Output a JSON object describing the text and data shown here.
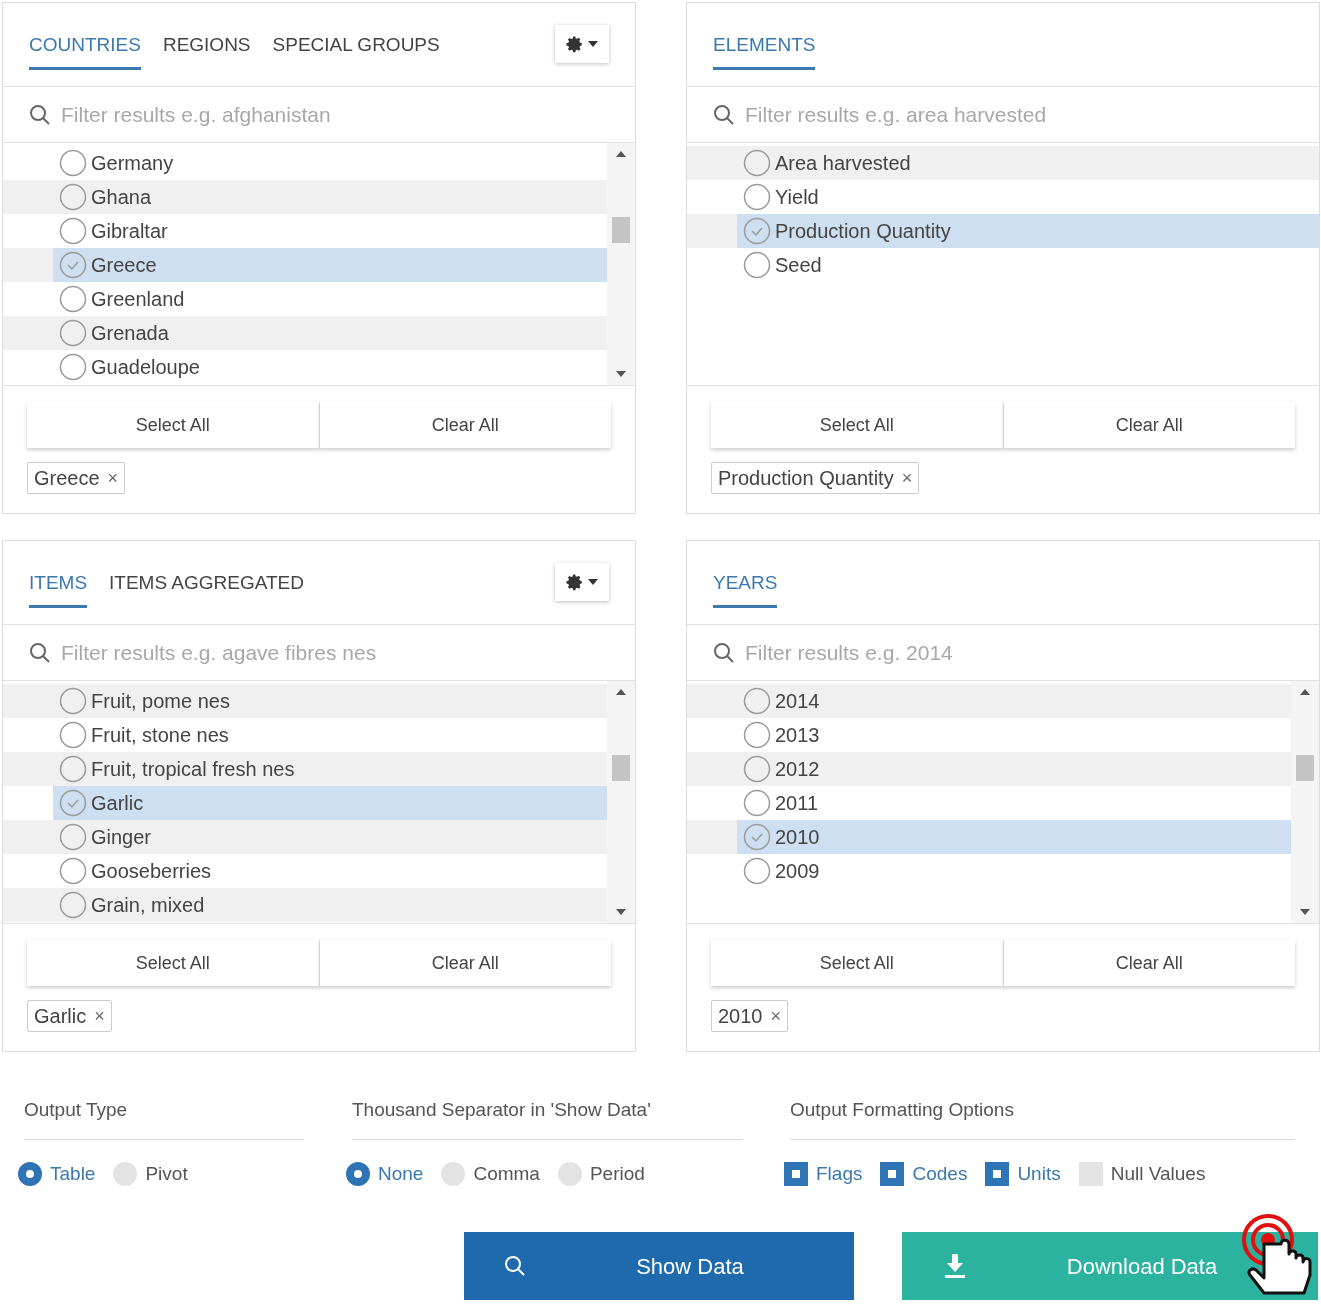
{
  "panels": [
    {
      "tabs": [
        {
          "label": "COUNTRIES",
          "selected": true
        },
        {
          "label": "REGIONS",
          "selected": false
        },
        {
          "label": "SPECIAL GROUPS",
          "selected": false
        }
      ],
      "settings_button": true,
      "search": {
        "placeholder": "Filter results e.g. afghanistan"
      },
      "scrollable": true,
      "first_row_shaded": false,
      "items": [
        {
          "label": "Germany",
          "selected": false
        },
        {
          "label": "Ghana",
          "selected": false
        },
        {
          "label": "Gibraltar",
          "selected": false
        },
        {
          "label": "Greece",
          "selected": true
        },
        {
          "label": "Greenland",
          "selected": false
        },
        {
          "label": "Grenada",
          "selected": false
        },
        {
          "label": "Guadeloupe",
          "selected": false
        }
      ],
      "select_all": "Select All",
      "clear_all": "Clear All",
      "chips": [
        {
          "label": "Greece",
          "remove": "×"
        }
      ]
    },
    {
      "tabs": [
        {
          "label": "ELEMENTS",
          "selected": true
        }
      ],
      "settings_button": false,
      "search": {
        "placeholder": "Filter results e.g. area harvested"
      },
      "scrollable": false,
      "first_row_shaded": true,
      "items": [
        {
          "label": "Area harvested",
          "selected": false
        },
        {
          "label": "Yield",
          "selected": false
        },
        {
          "label": "Production Quantity",
          "selected": true
        },
        {
          "label": "Seed",
          "selected": false
        }
      ],
      "select_all": "Select All",
      "clear_all": "Clear All",
      "chips": [
        {
          "label": "Production Quantity",
          "remove": "×"
        }
      ]
    },
    {
      "tabs": [
        {
          "label": "ITEMS",
          "selected": true
        },
        {
          "label": "ITEMS AGGREGATED",
          "selected": false
        }
      ],
      "settings_button": true,
      "search": {
        "placeholder": "Filter results e.g. agave fibres nes"
      },
      "scrollable": true,
      "first_row_shaded": true,
      "items": [
        {
          "label": "Fruit, pome nes",
          "selected": false
        },
        {
          "label": "Fruit, stone nes",
          "selected": false
        },
        {
          "label": "Fruit, tropical fresh nes",
          "selected": false
        },
        {
          "label": "Garlic",
          "selected": true
        },
        {
          "label": "Ginger",
          "selected": false
        },
        {
          "label": "Gooseberries",
          "selected": false
        },
        {
          "label": "Grain, mixed",
          "selected": false
        }
      ],
      "select_all": "Select All",
      "clear_all": "Clear All",
      "chips": [
        {
          "label": "Garlic",
          "remove": "×"
        }
      ]
    },
    {
      "tabs": [
        {
          "label": "YEARS",
          "selected": true
        }
      ],
      "settings_button": false,
      "search": {
        "placeholder": "Filter results e.g. 2014"
      },
      "scrollable": true,
      "first_row_shaded": true,
      "items": [
        {
          "label": "2014",
          "selected": false
        },
        {
          "label": "2013",
          "selected": false
        },
        {
          "label": "2012",
          "selected": false
        },
        {
          "label": "2011",
          "selected": false
        },
        {
          "label": "2010",
          "selected": true
        },
        {
          "label": "2009",
          "selected": false
        }
      ],
      "select_all": "Select All",
      "clear_all": "Clear All",
      "chips": [
        {
          "label": "2010",
          "remove": "×"
        }
      ]
    }
  ],
  "output_groups": [
    {
      "title": "Output Type",
      "kind": "radio",
      "options": [
        {
          "label": "Table",
          "selected": true
        },
        {
          "label": "Pivot",
          "selected": false
        }
      ]
    },
    {
      "title": "Thousand Separator in 'Show Data'",
      "kind": "radio",
      "options": [
        {
          "label": "None",
          "selected": true
        },
        {
          "label": "Comma",
          "selected": false
        },
        {
          "label": "Period",
          "selected": false
        }
      ]
    },
    {
      "title": "Output Formatting Options",
      "kind": "checkbox",
      "options": [
        {
          "label": "Flags",
          "checked": true
        },
        {
          "label": "Codes",
          "checked": true
        },
        {
          "label": "Units",
          "checked": true
        },
        {
          "label": "Null Values",
          "checked": false
        }
      ]
    }
  ],
  "actions": [
    {
      "label": "Show Data",
      "kind": "search"
    },
    {
      "label": "Download Data",
      "kind": "download"
    }
  ]
}
